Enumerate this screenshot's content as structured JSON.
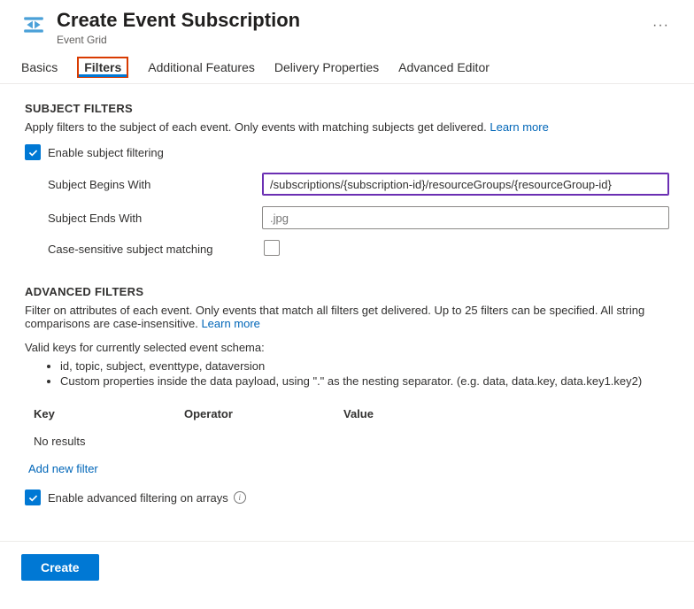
{
  "header": {
    "title": "Create Event Subscription",
    "subtitle": "Event Grid"
  },
  "tabs": {
    "items": [
      "Basics",
      "Filters",
      "Additional Features",
      "Delivery Properties",
      "Advanced Editor"
    ],
    "active": "Filters"
  },
  "subjectFilters": {
    "title": "SUBJECT FILTERS",
    "description": "Apply filters to the subject of each event. Only events with matching subjects get delivered.",
    "learnMore": "Learn more",
    "enableLabel": "Enable subject filtering",
    "enableChecked": true,
    "beginsWith": {
      "label": "Subject Begins With",
      "value": "/subscriptions/{subscription-id}/resourceGroups/{resourceGroup-id}"
    },
    "endsWith": {
      "label": "Subject Ends With",
      "value": "",
      "placeholder": ".jpg"
    },
    "caseSensitive": {
      "label": "Case-sensitive subject matching",
      "checked": false
    }
  },
  "advancedFilters": {
    "title": "ADVANCED FILTERS",
    "description": "Filter on attributes of each event. Only events that match all filters get delivered. Up to 25 filters can be specified. All string comparisons are case-insensitive.",
    "learnMore": "Learn more",
    "validKeysIntro": "Valid keys for currently selected event schema:",
    "bullets": [
      "id, topic, subject, eventtype, dataversion",
      "Custom properties inside the data payload, using \".\" as the nesting separator. (e.g. data, data.key, data.key1.key2)"
    ],
    "columns": {
      "key": "Key",
      "operator": "Operator",
      "value": "Value"
    },
    "rows": [],
    "noResults": "No results",
    "addNew": "Add new filter",
    "enableArrays": {
      "label": "Enable advanced filtering on arrays",
      "checked": true
    }
  },
  "footer": {
    "create": "Create"
  }
}
